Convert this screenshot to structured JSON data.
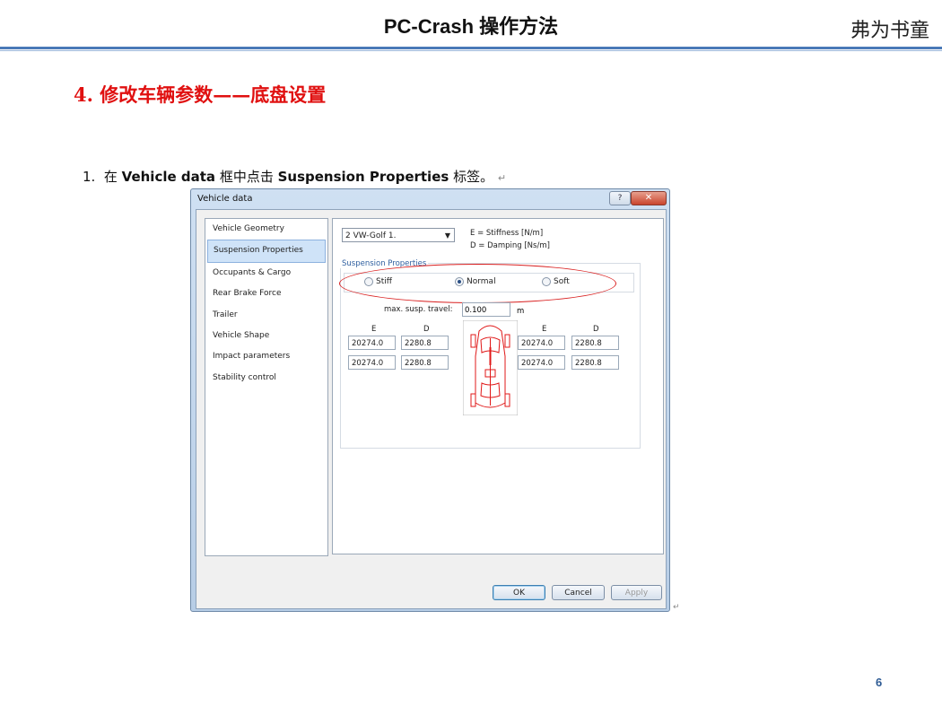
{
  "header": {
    "title": "PC-Crash 操作方法",
    "author": "弗为书童"
  },
  "section_title": "4. 修改车辆参数——底盘设置",
  "step": {
    "number": "1.",
    "pre": "在",
    "bold1": "Vehicle data",
    "mid": "框中点击",
    "bold2": "Suspension Properties",
    "post": "标签。",
    "return_mark": "↵"
  },
  "dialog": {
    "title": "Vehicle data",
    "help_icon": "?",
    "close_icon": "✕",
    "nav_items": [
      "Vehicle Geometry",
      "Suspension Properties",
      "Occupants & Cargo",
      "Rear Brake Force",
      "Trailer",
      "Vehicle Shape",
      "Impact parameters",
      "Stability control"
    ],
    "selected_nav": "Suspension Properties",
    "vehicle_select": "2 VW-Golf 1.",
    "legend_e": "E = Stiffness [N/m]",
    "legend_d": "D = Damping [Ns/m]",
    "group_label": "Suspension Properties",
    "radios": {
      "stiff": "Stiff",
      "normal": "Normal",
      "soft": "Soft",
      "selected": "Normal"
    },
    "travel_label": "max. susp. travel:",
    "travel_value": "0.100",
    "travel_unit": "m",
    "col_e": "E",
    "col_d": "D",
    "left": {
      "front": {
        "e": "20274.0",
        "d": "2280.8"
      },
      "rear": {
        "e": "20274.0",
        "d": "2280.8"
      }
    },
    "right": {
      "front": {
        "e": "20274.0",
        "d": "2280.8"
      },
      "rear": {
        "e": "20274.0",
        "d": "2280.8"
      }
    },
    "buttons": {
      "ok": "OK",
      "cancel": "Cancel",
      "apply": "Apply"
    },
    "accent_color": "#d92020"
  },
  "page_number": "6"
}
